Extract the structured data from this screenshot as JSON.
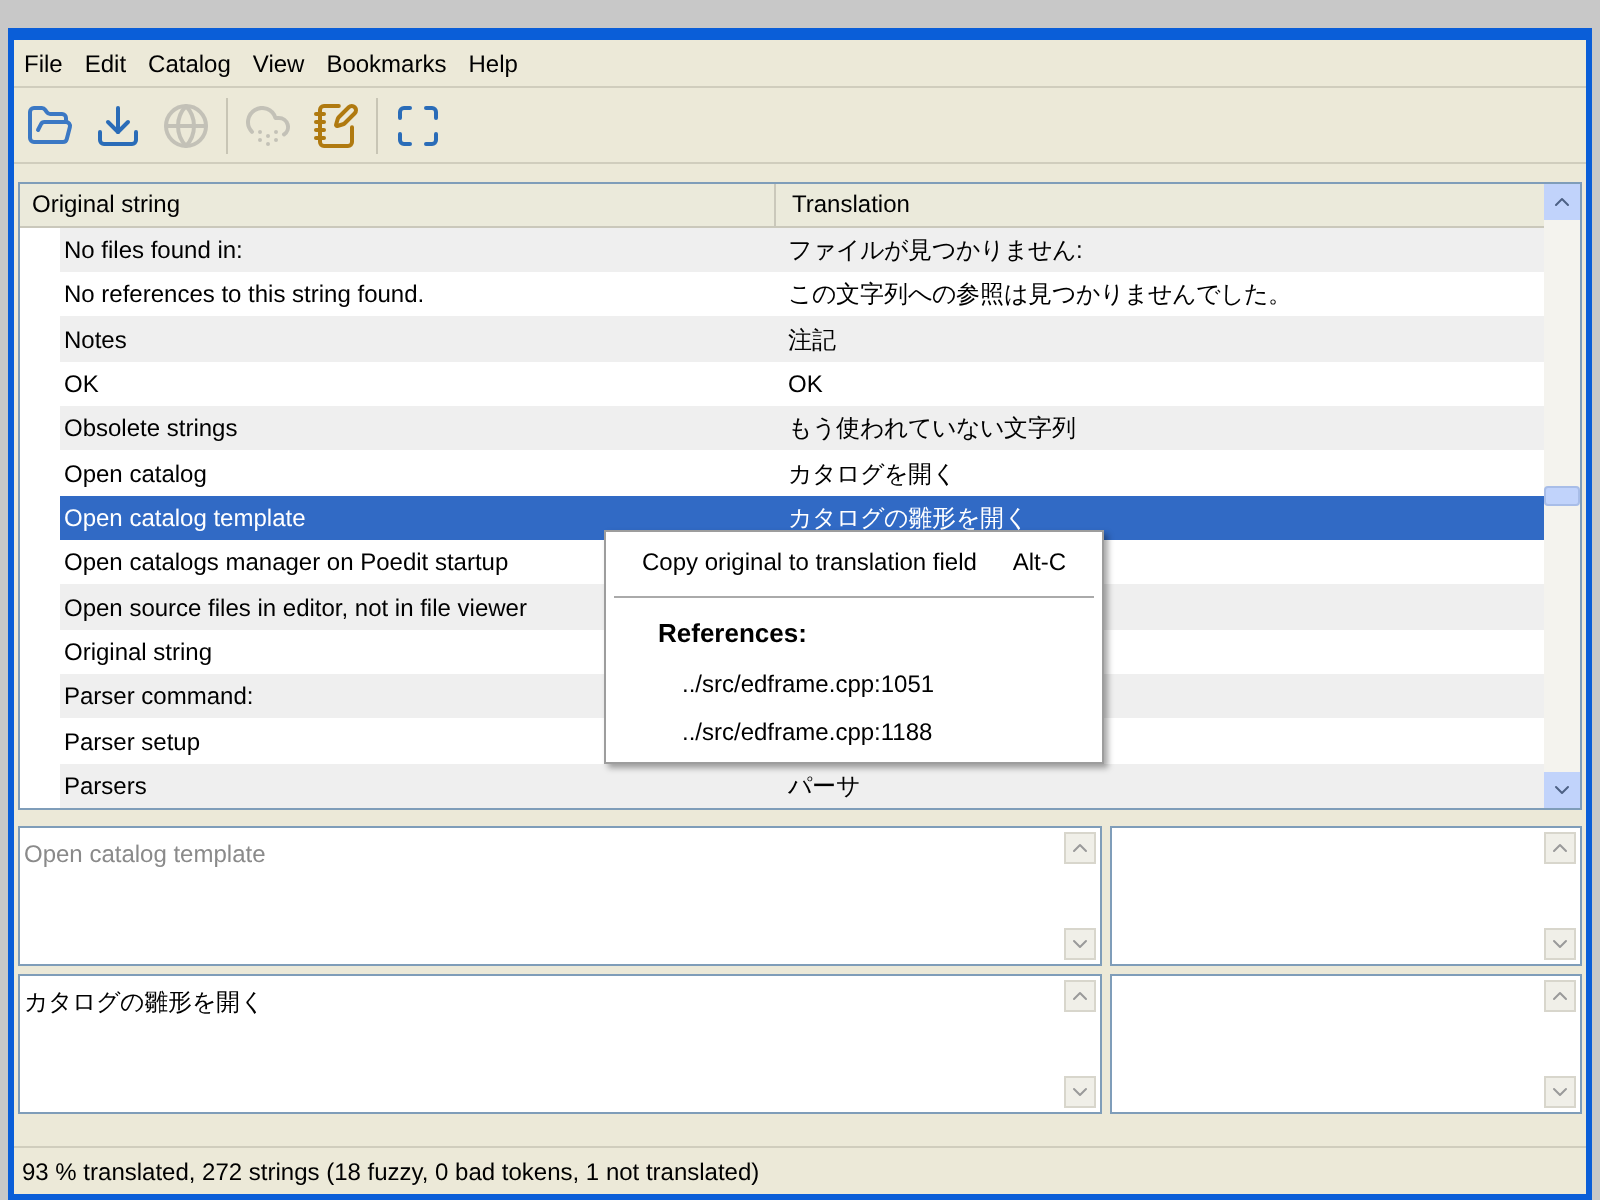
{
  "menu": [
    "File",
    "Edit",
    "Catalog",
    "View",
    "Bookmarks",
    "Help"
  ],
  "toolbar": [
    {
      "kind": "open",
      "disabled": false
    },
    {
      "kind": "save",
      "disabled": false
    },
    {
      "kind": "globe",
      "disabled": true
    },
    {
      "kind": "update",
      "disabled": true
    },
    {
      "kind": "edit",
      "disabled": false
    },
    {
      "kind": "fullscreen",
      "disabled": false
    }
  ],
  "table": {
    "columns": [
      "Original string",
      "Translation"
    ],
    "rows": [
      {
        "original": "No files found in:",
        "translation": "ファイルが見つかりません:",
        "selected": false
      },
      {
        "original": "No references to this string found.",
        "translation": "この文字列への参照は見つかりませんでした。",
        "selected": false
      },
      {
        "original": "Notes",
        "translation": "注記",
        "selected": false
      },
      {
        "original": "OK",
        "translation": "OK",
        "selected": false
      },
      {
        "original": "Obsolete strings",
        "translation": "もう使われていない文字列",
        "selected": false
      },
      {
        "original": "Open catalog",
        "translation": "カタログを開く",
        "selected": false
      },
      {
        "original": "Open catalog template",
        "translation": "カタログの雛形を開く",
        "selected": true
      },
      {
        "original": "Open catalogs manager on Poedit startup",
        "selected": false
      },
      {
        "original": "Open source files in editor, not in file viewer",
        "selected": false
      },
      {
        "original": "Original string",
        "selected": false
      },
      {
        "original": "Parser command:",
        "selected": false
      },
      {
        "original": "Parser setup",
        "selected": false
      },
      {
        "original": "Parsers",
        "translation": "パーサ",
        "selected": false
      }
    ]
  },
  "context_menu": {
    "item": {
      "label": "Copy original to translation field",
      "shortcut": "Alt-C"
    },
    "references_title": "References:",
    "references": [
      "../src/edframe.cpp:1051",
      "../src/edframe.cpp:1188"
    ]
  },
  "original_text": "Open catalog template",
  "translation_text": "カタログの雛形を開く",
  "status_bar": "93 % translated, 272 strings (18 fuzzy, 0 bad tokens, 1 not translated)"
}
